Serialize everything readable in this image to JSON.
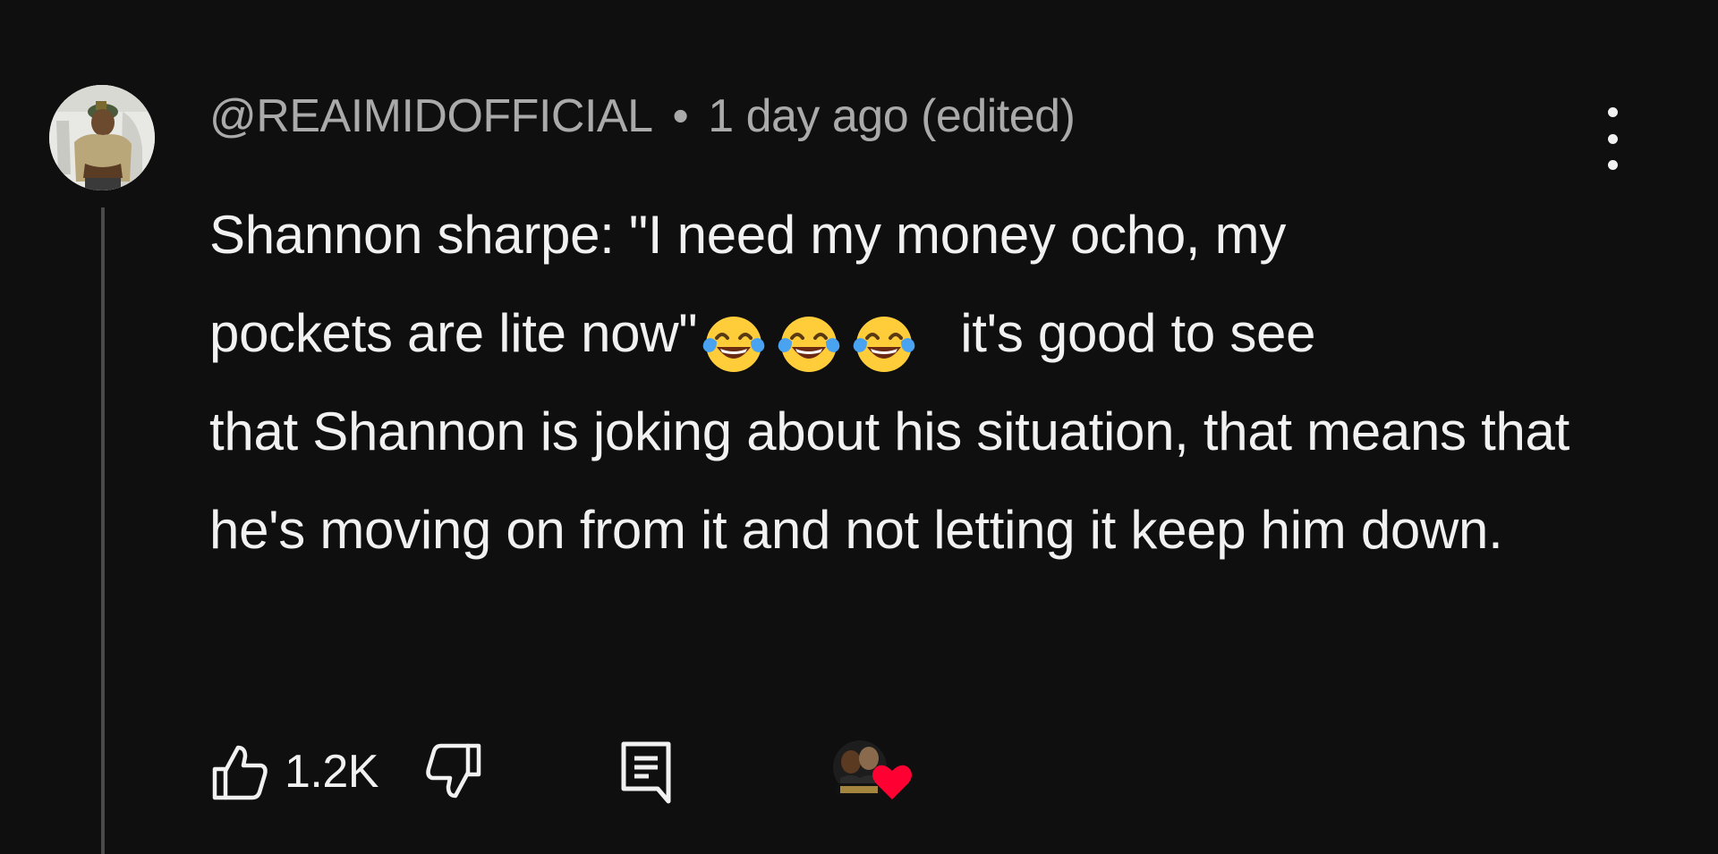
{
  "comment": {
    "author": "@REAIMIDOFFICIAL",
    "separator": "•",
    "timestamp": "1 day ago (edited)",
    "text_line1": "Shannon sharpe: \"I need my money ocho, my",
    "text_line2_before": "pockets are lite now\"",
    "emojis": [
      "face-with-tears-of-joy",
      "face-with-tears-of-joy",
      "face-with-tears-of-joy"
    ],
    "text_line2_after": "it's good to see",
    "text_rest": "that Shannon is joking about his situation, that means that he's moving on from it and not letting it keep him down.",
    "like_count": "1.2K",
    "icons": {
      "like": "thumbs-up-icon",
      "dislike": "thumbs-down-icon",
      "reply": "reply-comment-icon",
      "menu": "more-vertical-icon",
      "creator_heart": "creator-heart-icon"
    },
    "colors": {
      "background": "#0f0f0f",
      "text": "#f1f1f1",
      "meta": "#aaaaaa",
      "heart": "#ff0033"
    }
  }
}
